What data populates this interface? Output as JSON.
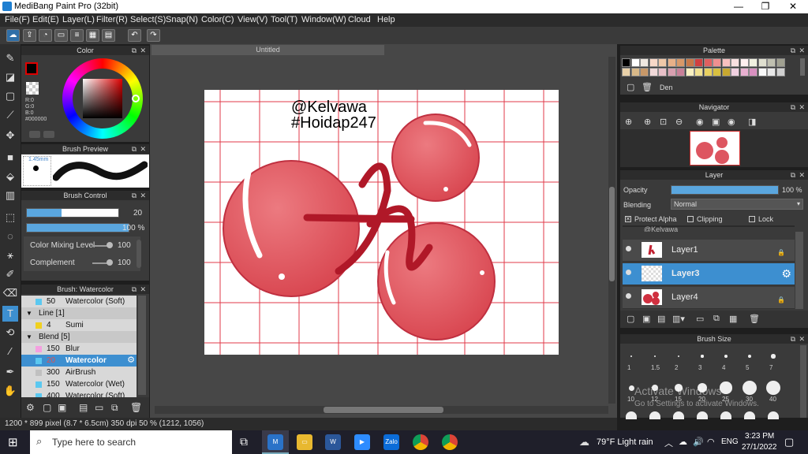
{
  "window": {
    "title": "MediBang Paint Pro (32bit)",
    "minimize": "—",
    "restore": "❐",
    "close": "✕"
  },
  "menu": [
    "File(F)",
    "Edit(E)",
    "Layer(L)",
    "Filter(R)",
    "Select(S)",
    "Snap(N)",
    "Color(C)",
    "View(V)",
    "Tool(T)",
    "Window(W)",
    "Cloud",
    "Help"
  ],
  "color_panel": {
    "title": "Color",
    "r": "R:0",
    "g": "G:0",
    "b": "B:0",
    "hex": "#000000"
  },
  "brush_preview": {
    "title": "Brush Preview",
    "size": "1.45mm"
  },
  "brush_control": {
    "title": "Brush Control",
    "size_value": "20",
    "opacity_value": "100 %",
    "opacity": 1.0,
    "size_level": 0.38,
    "color_mixing_label": "Color Mixing Level",
    "color_mixing_value": "100",
    "complement_label": "Complement",
    "complement_value": "100"
  },
  "brush_list": {
    "title": "Brush: Watercolor",
    "items": [
      {
        "num": "50",
        "label": "Watercolor (Soft)",
        "type": "item",
        "color": "#5bc8f0"
      },
      {
        "num": "",
        "label": "Line [1]",
        "type": "group",
        "expand": "▼"
      },
      {
        "num": "4",
        "label": "Sumi",
        "type": "item",
        "color": "#f0d020"
      },
      {
        "num": "",
        "label": "Blend [5]",
        "type": "group",
        "expand": "▼"
      },
      {
        "num": "150",
        "label": "Blur",
        "type": "item",
        "color": "#f4a0e0"
      },
      {
        "num": "20",
        "label": "Watercolor",
        "type": "selected",
        "color": "#5bc8f0"
      },
      {
        "num": "300",
        "label": "AirBrush",
        "type": "item",
        "color": "#c0c0c0"
      },
      {
        "num": "150",
        "label": "Watercolor (Wet)",
        "type": "item",
        "color": "#5bc8f0"
      },
      {
        "num": "400",
        "label": "Watercolor (Soft)",
        "type": "item",
        "color": "#5bc8f0"
      }
    ]
  },
  "document": {
    "tab": "Untitled",
    "line1": "@Kelvawa",
    "line2": "#Hoidap247"
  },
  "palette": {
    "title": "Palette",
    "set_name": "Den"
  },
  "navigator": {
    "title": "Navigator"
  },
  "layer_panel": {
    "title": "Layer",
    "opacity_label": "Opacity",
    "opacity_value": "100 %",
    "opacity": 1.0,
    "blending_label": "Blending",
    "blending_value": "Normal",
    "protect_alpha": "Protect Alpha",
    "clipping": "Clipping",
    "lock": "Lock",
    "partial_layer": "@Kelvawa",
    "layers": [
      {
        "name": "Layer1",
        "selected": false
      },
      {
        "name": "Layer3",
        "selected": true
      },
      {
        "name": "Layer4",
        "selected": false
      }
    ]
  },
  "brush_size": {
    "title": "Brush Size",
    "labels": [
      "1",
      "1.5",
      "2",
      "3",
      "4",
      "5",
      "7",
      "10",
      "12",
      "15",
      "20",
      "25",
      "30",
      "40"
    ]
  },
  "status": {
    "text": "1200 * 899 pixel  (8.7 * 6.5cm)  350 dpi  50 %  (1212, 1056)"
  },
  "watermark": {
    "line1": "Activate Windows",
    "line2": "Go to Settings to activate Windows."
  },
  "taskbar": {
    "search_placeholder": "Type here to search",
    "weather": "79°F  Light rain",
    "lang": "ENG",
    "time": "3:23 PM",
    "date": "27/1/2022"
  },
  "colors": {
    "accent": "#5aa6de",
    "selected_row": "#3d8fd0",
    "bubble": "#e05a62"
  }
}
